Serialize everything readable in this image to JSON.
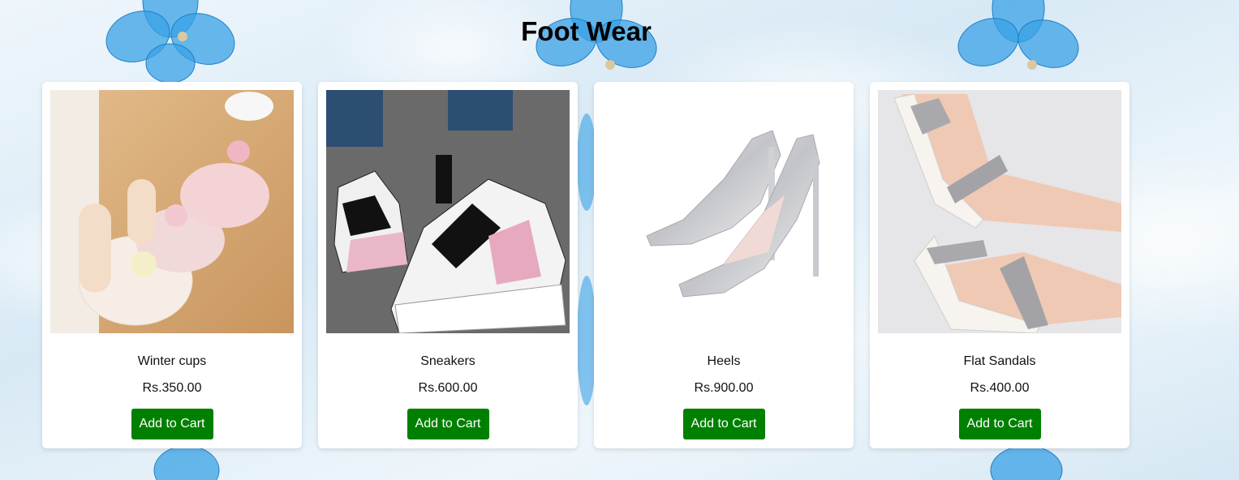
{
  "page": {
    "title": "Foot Wear"
  },
  "products": [
    {
      "name": "Winter cups",
      "price": "Rs.350.00",
      "button_label": "Add to Cart",
      "image_icon": "fluffy-flower-slippers-icon"
    },
    {
      "name": "Sneakers",
      "price": "Rs.600.00",
      "button_label": "Add to Cart",
      "image_icon": "chunky-sneakers-icon"
    },
    {
      "name": "Heels",
      "price": "Rs.900.00",
      "button_label": "Add to Cart",
      "image_icon": "silver-glitter-heels-icon"
    },
    {
      "name": "Flat Sandals",
      "price": "Rs.400.00",
      "button_label": "Add to Cart",
      "image_icon": "grey-flat-sandals-icon"
    }
  ],
  "colors": {
    "button_background": "#008000",
    "button_text": "#ffffff",
    "card_background": "#ffffff",
    "flower_accent": "#2f9be0"
  }
}
